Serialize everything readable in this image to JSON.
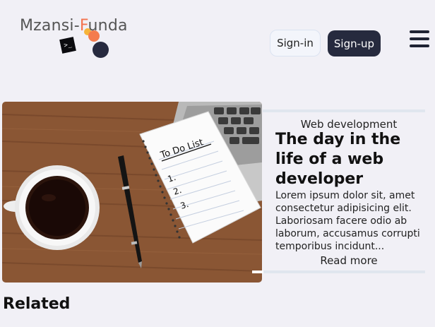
{
  "header": {
    "logo": {
      "text_before": "Mzansi-",
      "text_accent": "F",
      "text_after": "unda",
      "terminal_glyph": ">_"
    },
    "signin_label": "Sign-in",
    "signup_label": "Sign-up",
    "menu_icon": "hamburger-menu-icon"
  },
  "featured": {
    "category": "Web development",
    "title": "The day in the life of a web developer",
    "excerpt": "Lorem ipsum dolor sit, amet consectetur adipisicing elit. Laboriosam facere odio ab laborum, accusamus corrupti temporibus incidunt...",
    "read_more": "Read more",
    "image": {
      "note_heading": "To Do List",
      "note_items": [
        "1.",
        "2.",
        "3."
      ]
    }
  },
  "related": {
    "heading": "Related"
  },
  "colors": {
    "background": "#f1f0f6",
    "primary_button": "#262a3e",
    "logo_accent": "#f4734f"
  }
}
